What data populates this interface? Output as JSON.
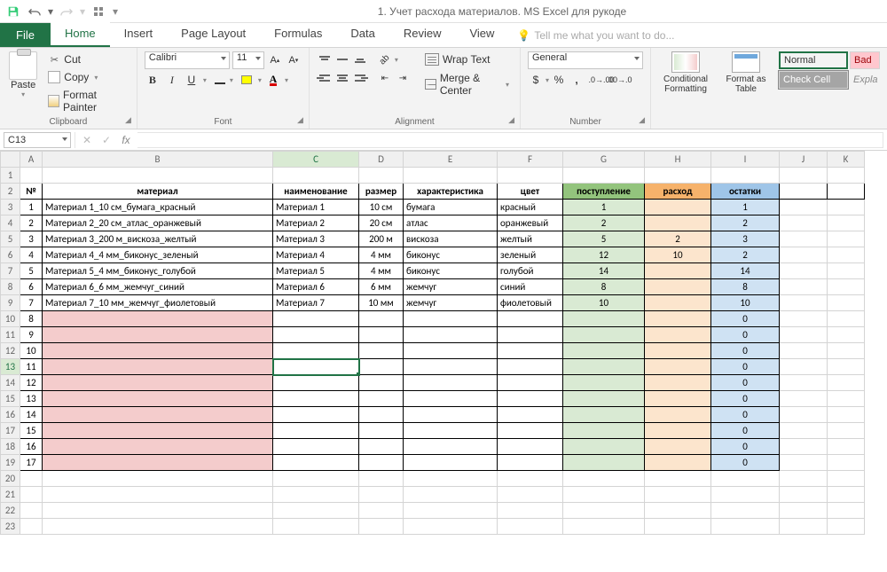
{
  "title": "1. Учет расхода материалов. MS Excel для рукоде",
  "tabs": {
    "file": "File",
    "home": "Home",
    "insert": "Insert",
    "pagelayout": "Page Layout",
    "formulas": "Formulas",
    "data": "Data",
    "review": "Review",
    "view": "View",
    "tellme": "Tell me what you want to do..."
  },
  "clipboard": {
    "paste": "Paste",
    "cut": "Cut",
    "copy": "Copy",
    "painter": "Format Painter",
    "group": "Clipboard"
  },
  "font": {
    "name": "Calibri",
    "size": "11",
    "group": "Font"
  },
  "alignment": {
    "wrap": "Wrap Text",
    "merge": "Merge & Center",
    "group": "Alignment"
  },
  "number": {
    "format": "General",
    "group": "Number"
  },
  "styles": {
    "cf": "Conditional Formatting",
    "fat": "Format as Table",
    "normal": "Normal",
    "bad": "Bad",
    "check": "Check Cell",
    "expl": "Expla"
  },
  "formula_bar": {
    "name_box": "C13"
  },
  "columns": [
    "A",
    "B",
    "C",
    "D",
    "E",
    "F",
    "G",
    "H",
    "I",
    "J",
    "K"
  ],
  "row_headers": [
    "1",
    "2",
    "3",
    "4",
    "5",
    "6",
    "7",
    "8",
    "9",
    "10",
    "11",
    "12",
    "13",
    "14",
    "15",
    "16",
    "17",
    "18",
    "19",
    "20",
    "21",
    "22",
    "23"
  ],
  "header_row": {
    "num": "№",
    "material": "материал",
    "name": "наименование",
    "size": "размер",
    "char": "характеристика",
    "color": "цвет",
    "in": "поступление",
    "out": "расход",
    "rest": "остатки"
  },
  "rows": [
    {
      "n": "1",
      "mat": "Материал 1_10 см_бумага_красный",
      "name": "Материал 1",
      "size": "10 см",
      "char": "бумага",
      "color": "красный",
      "in": "1",
      "out": "",
      "rest": "1"
    },
    {
      "n": "2",
      "mat": "Материал 2_20 см_атлас_оранжевый",
      "name": "Материал 2",
      "size": "20 см",
      "char": "атлас",
      "color": "оранжевый",
      "in": "2",
      "out": "",
      "rest": "2"
    },
    {
      "n": "3",
      "mat": "Материал 3_200 м_вискоза_желтый",
      "name": "Материал 3",
      "size": "200 м",
      "char": "вискоза",
      "color": "желтый",
      "in": "5",
      "out": "2",
      "rest": "3"
    },
    {
      "n": "4",
      "mat": "Материал 4_4 мм_биконус_зеленый",
      "name": "Материал 4",
      "size": "4 мм",
      "char": "биконус",
      "color": "зеленый",
      "in": "12",
      "out": "10",
      "rest": "2"
    },
    {
      "n": "5",
      "mat": "Материал 5_4 мм_биконус_голубой",
      "name": "Материал 5",
      "size": "4 мм",
      "char": "биконус",
      "color": "голубой",
      "in": "14",
      "out": "",
      "rest": "14"
    },
    {
      "n": "6",
      "mat": "Материал 6_6 мм_жемчуг_синий",
      "name": "Материал 6",
      "size": "6 мм",
      "char": "жемчуг",
      "color": "синий",
      "in": "8",
      "out": "",
      "rest": "8"
    },
    {
      "n": "7",
      "mat": "Материал 7_10 мм_жемчуг_фиолетовый",
      "name": "Материал 7",
      "size": "10 мм",
      "char": "жемчуг",
      "color": "фиолетовый",
      "in": "10",
      "out": "",
      "rest": "10"
    }
  ],
  "empty_rows": [
    "8",
    "9",
    "10",
    "11",
    "12",
    "13",
    "14",
    "15",
    "16",
    "17"
  ],
  "rest_zero": "0",
  "active_cell": "C13"
}
